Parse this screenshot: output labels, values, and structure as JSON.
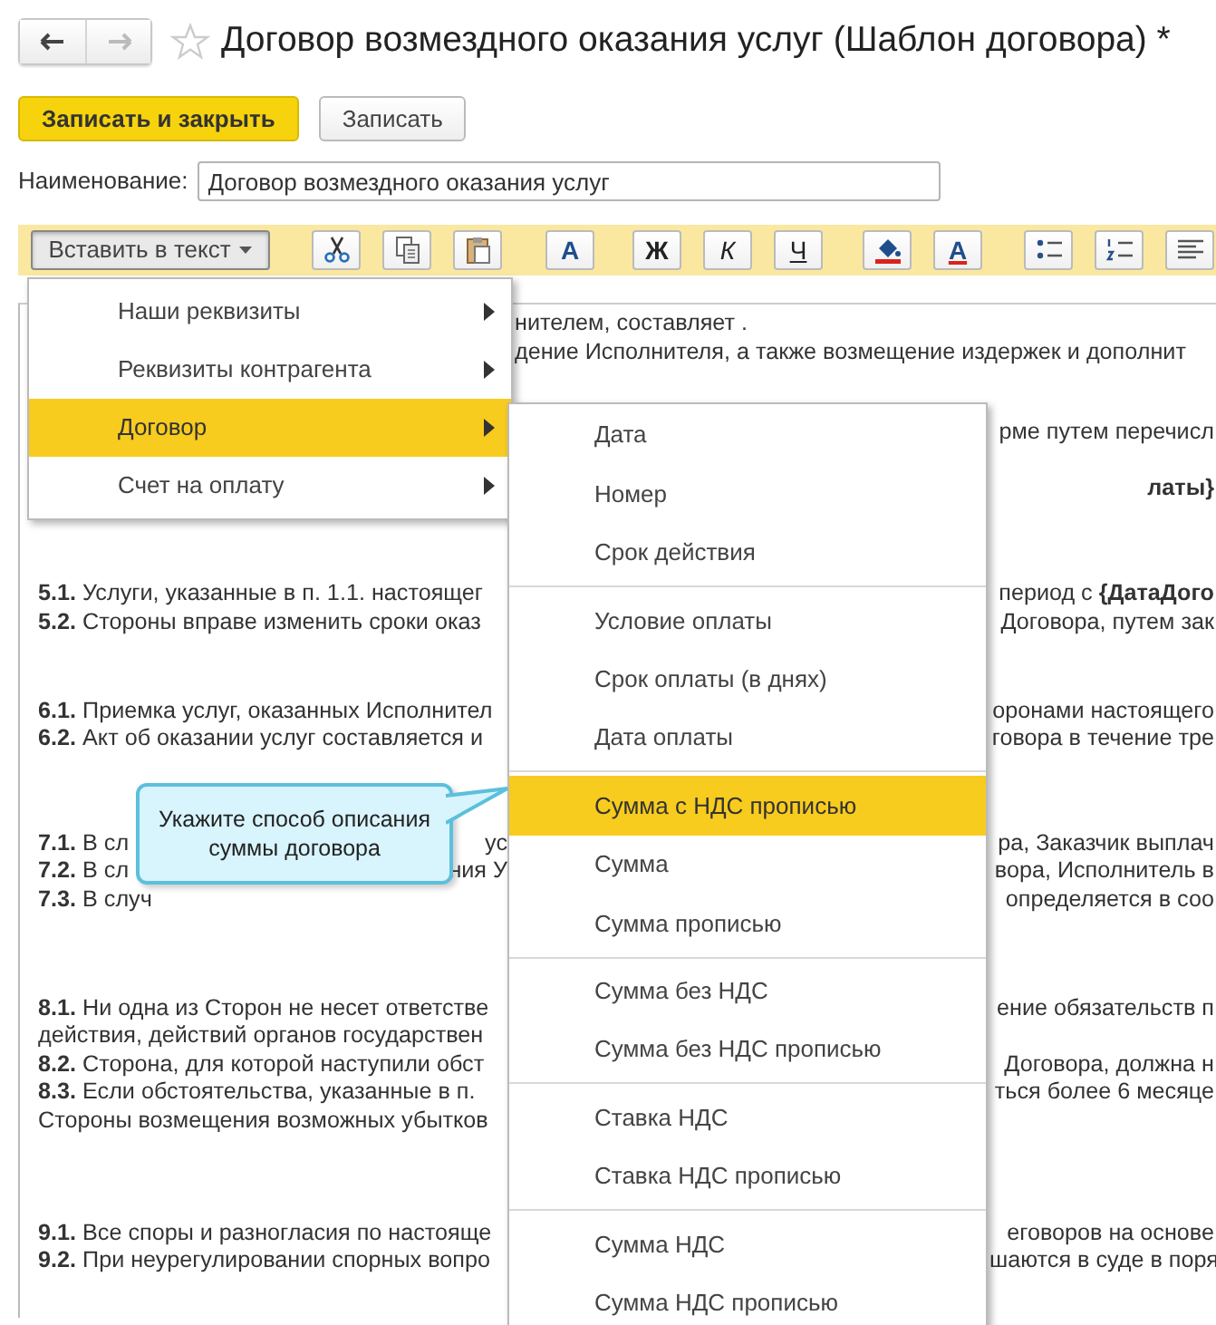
{
  "window": {
    "title": "Договор возмездного оказания услуг (Шаблон договора) *",
    "favorite": false
  },
  "actions": [
    {
      "label": "Записать и закрыть",
      "kind": "primary"
    },
    {
      "label": "Записать",
      "kind": "default"
    }
  ],
  "name_field": {
    "label": "Наименование:",
    "value": "Договор возмездного оказания услуг"
  },
  "toolbar": [
    {
      "kind": "dropdown",
      "label": "Вставить в текст",
      "pressed": true
    },
    {
      "kind": "cut"
    },
    {
      "kind": "copy"
    },
    {
      "kind": "paste"
    },
    {
      "kind": "letter",
      "label": "A"
    },
    {
      "kind": "letter",
      "label": "Ж"
    },
    {
      "kind": "letter",
      "label": "К"
    },
    {
      "kind": "letter",
      "label": "Ч"
    },
    {
      "kind": "fill"
    },
    {
      "kind": "textcolor",
      "label": "A"
    },
    {
      "kind": "bullets"
    },
    {
      "kind": "numbers"
    },
    {
      "kind": "align"
    }
  ],
  "document": [
    [
      {
        "center": "нителем, составляет ."
      },
      {
        "center": "дение Исполнителя, а также возмещение издержек и дополнит"
      }
    ],
    [
      {
        "right": "рме путем перечисл"
      }
    ],
    [
      {
        "right": "**латы}**"
      }
    ],
    [
      {
        "left": "**5.1.** Услуги, указанные в п. 1.1. настоящег",
        "right": "период с **{ДатаДого**"
      },
      {
        "left": "**5.2.** Стороны вправе изменить сроки оказ",
        "right": "Договора, путем зак"
      }
    ],
    [
      {
        "left": "**6.1.** Приемка услуг, оказанных Исполнител",
        "right": "оронами настоящего"
      },
      {
        "left": "**6.2.** Акт об оказании услуг составляется и",
        "right": "говора в течение тре"
      }
    ],
    [
      {
        "left": "**7.1.** В сл",
        "mid": "ус",
        "right": "ра, Заказчик выплач"
      },
      {
        "left": "**7.2.** В сл",
        "mid": "ния У",
        "right": "вора, Исполнитель в"
      },
      {
        "left": "**7.3.** В случ",
        "right": "определяется в соо"
      }
    ],
    [
      {
        "left": "**8.1.** Ни одна из Сторон не несет ответстве",
        "right": "ение обязательств п"
      },
      {
        "left": "действия, действий органов государствен"
      },
      {
        "left": "**8.2.** Сторона, для которой наступили обст",
        "right": "Договора, должна н"
      },
      {
        "left": "**8.3.** Если обстоятельства, указанные в п.",
        "right": "ться более 6 месяце"
      },
      {
        "left": "Стороны возмещения возможных убытков"
      }
    ],
    [
      {
        "left": "**9.1.** Все споры и разногласия по настояще",
        "right": "еговоров на основе"
      },
      {
        "left": "**9.2.** При неурегулировании спорных вопро",
        "right": "шаются в суде в поря"
      }
    ]
  ],
  "insert_menu": [
    {
      "label": "Наши реквизиты",
      "selected": false
    },
    {
      "label": "Реквизиты контрагента",
      "selected": false
    },
    {
      "label": "Договор",
      "selected": true
    },
    {
      "label": "Счет на оплату",
      "selected": false
    }
  ],
  "submenu": [
    [
      {
        "label": "Дата",
        "selected": false
      },
      {
        "label": "Номер",
        "selected": false
      },
      {
        "label": "Срок действия",
        "selected": false
      }
    ],
    [
      {
        "label": "Условие оплаты",
        "selected": false
      },
      {
        "label": "Срок оплаты (в днях)",
        "selected": false
      },
      {
        "label": "Дата оплаты",
        "selected": false
      }
    ],
    [
      {
        "label": "Сумма с НДС прописью",
        "selected": true
      },
      {
        "label": "Сумма",
        "selected": false
      },
      {
        "label": "Сумма прописью",
        "selected": false
      }
    ],
    [
      {
        "label": "Сумма без НДС",
        "selected": false
      },
      {
        "label": "Сумма без НДС прописью",
        "selected": false
      }
    ],
    [
      {
        "label": "Ставка НДС",
        "selected": false
      },
      {
        "label": "Ставка НДС прописью",
        "selected": false
      }
    ],
    [
      {
        "label": "Сумма НДС",
        "selected": false
      },
      {
        "label": "Сумма НДС прописью",
        "selected": false
      }
    ]
  ],
  "hint": {
    "text": "Укажите способ описания суммы договора"
  }
}
